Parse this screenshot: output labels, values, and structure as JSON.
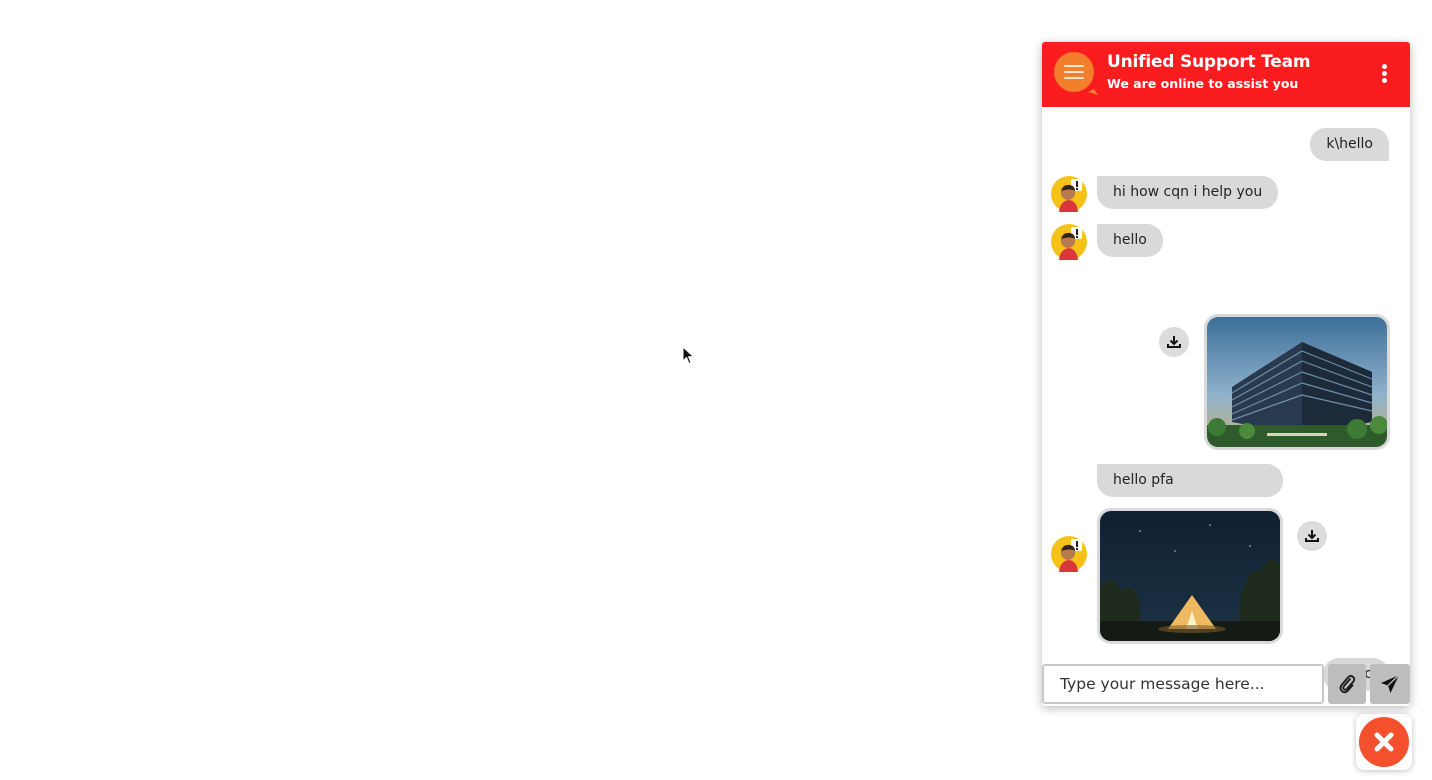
{
  "header": {
    "title": "Unified Support Team",
    "subtitle": "We are online to assist you",
    "background_color": "#fb1c1f",
    "avatar_icon": "chat-bubble-menu-icon",
    "menu_icon": "kebab-menu-icon"
  },
  "messages": [
    {
      "sender": "user",
      "type": "text",
      "text": "k\\hello"
    },
    {
      "sender": "agent",
      "type": "text",
      "text": "hi how cqn i help you"
    },
    {
      "sender": "agent",
      "type": "text",
      "text": "hello"
    },
    {
      "sender": "user",
      "type": "image",
      "image": "office-building-photo",
      "action_icon": "download-icon"
    },
    {
      "sender": "agent",
      "type": "text",
      "text": "hello pfa"
    },
    {
      "sender": "agent",
      "type": "image",
      "image": "night-tent-photo",
      "action_icon": "download-icon"
    },
    {
      "sender": "user",
      "type": "text",
      "text": "hello"
    }
  ],
  "composer": {
    "placeholder": "Type your message here...",
    "attach_icon": "paperclip-icon",
    "send_icon": "paper-plane-icon"
  },
  "launcher": {
    "icon": "close-icon",
    "color": "#f4502e"
  },
  "colors": {
    "bubble": "#d9d9d9",
    "accent": "#fb1c1f"
  }
}
